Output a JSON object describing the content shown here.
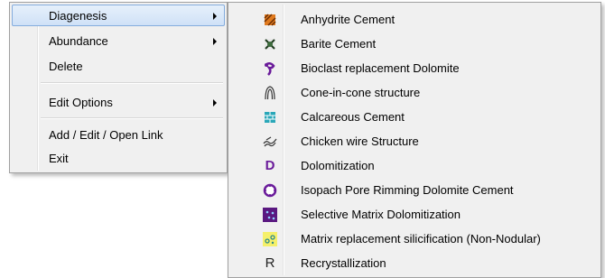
{
  "main_menu": {
    "items": [
      {
        "label": "Diagenesis",
        "has_submenu": true,
        "highlighted": true
      },
      {
        "label": "Abundance",
        "has_submenu": true
      },
      {
        "label": "Delete",
        "has_submenu": false
      },
      {
        "label": "Edit Options",
        "has_submenu": true
      },
      {
        "label": "Add / Edit / Open Link",
        "has_submenu": false
      },
      {
        "label": "Exit",
        "has_submenu": false
      }
    ]
  },
  "submenu": {
    "items": [
      {
        "label": "Anhydrite Cement",
        "icon": "anhydrite-cement-icon"
      },
      {
        "label": "Barite Cement",
        "icon": "barite-cement-icon"
      },
      {
        "label": "Bioclast replacement Dolomite",
        "icon": "bioclast-dolomite-icon"
      },
      {
        "label": "Cone-in-cone structure",
        "icon": "cone-in-cone-icon"
      },
      {
        "label": "Calcareous Cement",
        "icon": "calcareous-cement-icon"
      },
      {
        "label": "Chicken wire Structure",
        "icon": "chicken-wire-icon"
      },
      {
        "label": "Dolomitization",
        "icon": "dolomitization-icon"
      },
      {
        "label": "Isopach Pore Rimming Dolomite Cement",
        "icon": "isopach-pore-icon"
      },
      {
        "label": "Selective Matrix Dolomitization",
        "icon": "selective-matrix-icon"
      },
      {
        "label": "Matrix replacement silicification (Non-Nodular)",
        "icon": "matrix-silicification-icon"
      },
      {
        "label": "Recrystallization",
        "icon": "recrystallization-icon"
      }
    ]
  },
  "icon_glyphs": {
    "dolomitization": "D",
    "recrystallization": "R"
  },
  "colors": {
    "highlight_border": "#84acdd",
    "purple": "#6a1b9a",
    "anhydrite": "#e07a1f",
    "calcareous": "#2aa7b8",
    "silica_bg": "#f5f06a"
  }
}
